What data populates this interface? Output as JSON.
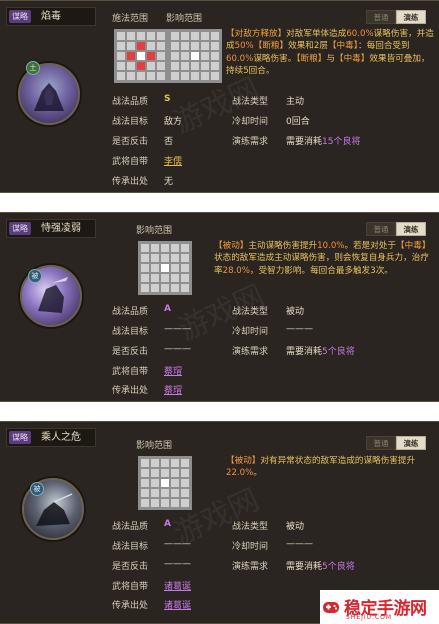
{
  "cards": [
    {
      "tag": "谋略",
      "name": "焰毒",
      "badge": "土",
      "range_label_1": "施法范围",
      "range_label_2": "影响范围",
      "tab_normal": "普通",
      "tab_active": "演练",
      "desc": {
        "p1": "【对敌方释放】",
        "p2": "对敌军单体造成",
        "p3": "60.0%",
        "p4": "谋略伤害，并造成",
        "p5": "50%",
        "p6": "【断粮】",
        "p7": "效果和2层",
        "p8": "【中毒】",
        "p9": "：每回合受到",
        "p10": "60.0%",
        "p11": "谋略伤害。",
        "p12": "【断粮】",
        "p13": "与",
        "p14": "【中毒】",
        "p15": "效果皆可叠加，持续5回合。"
      },
      "stats": {
        "quality_label": "战法品质",
        "quality": "S",
        "type_label": "战法类型",
        "type": "主动",
        "target_label": "战法目标",
        "target": "敌方",
        "cooldown_label": "冷却时间",
        "cooldown": "0回合",
        "counter_label": "是否反击",
        "counter": "否",
        "drill_label": "演练需求",
        "drill_pre": "需要消耗",
        "drill_count": "15个",
        "drill_post": "良将",
        "hero_label": "武将自带",
        "hero": "李儒",
        "inherit_label": "传承出处",
        "inherit": "无"
      }
    },
    {
      "tag": "谋略",
      "name": "恃强凌弱",
      "badge": "被",
      "range_label_2": "影响范围",
      "tab_normal": "普通",
      "tab_active": "演练",
      "desc": {
        "p1": "【被动】",
        "p2": "主动谋略伤害提升",
        "p3": "10.0%",
        "p4": "。若是对处于",
        "p5": "【中毒】",
        "p6": "状态的敌军造成主动谋略伤害，则会恢复自身兵力，治疗率",
        "p7": "28.0%",
        "p8": "，受智力影响。每回合最多触发3次。"
      },
      "stats": {
        "quality_label": "战法品质",
        "quality": "A",
        "type_label": "战法类型",
        "type": "被动",
        "target_label": "战法目标",
        "target": "———",
        "cooldown_label": "冷却时间",
        "cooldown": "———",
        "counter_label": "是否反击",
        "counter": "———",
        "drill_label": "演练需求",
        "drill_pre": "需要消耗",
        "drill_count": "5个",
        "drill_post": "良将",
        "hero_label": "武将自带",
        "hero": "蔡瑁",
        "inherit_label": "传承出处",
        "inherit": "蔡瑁"
      }
    },
    {
      "tag": "谋略",
      "name": "乘人之危",
      "badge": "被",
      "range_label_2": "影响范围",
      "tab_normal": "普通",
      "tab_active": "演练",
      "desc": {
        "p1": "【被动】",
        "p2": "对有异常状态的敌军造成的谋略伤害提升",
        "p3": "22.0%",
        "p4": "。"
      },
      "stats": {
        "quality_label": "战法品质",
        "quality": "A",
        "type_label": "战法类型",
        "type": "被动",
        "target_label": "战法目标",
        "target": "———",
        "cooldown_label": "冷却时间",
        "cooldown": "———",
        "counter_label": "是否反击",
        "counter": "———",
        "drill_label": "演练需求",
        "drill_pre": "需要消耗",
        "drill_count": "5个",
        "drill_post": "良将",
        "hero_label": "武将自带",
        "hero": "诸葛诞",
        "inherit_label": "传承出处",
        "inherit": "诸葛诞"
      }
    }
  ],
  "watermark": "游戏网",
  "logo": {
    "text": "稳定手游网",
    "sub": "SHEJIU.COM"
  },
  "colors": {
    "accent_red": "#e04040",
    "gold": "#e6c060",
    "purple": "#c878e8",
    "tag_purple": "#5a3d7d",
    "logo_red": "#d8262e"
  }
}
